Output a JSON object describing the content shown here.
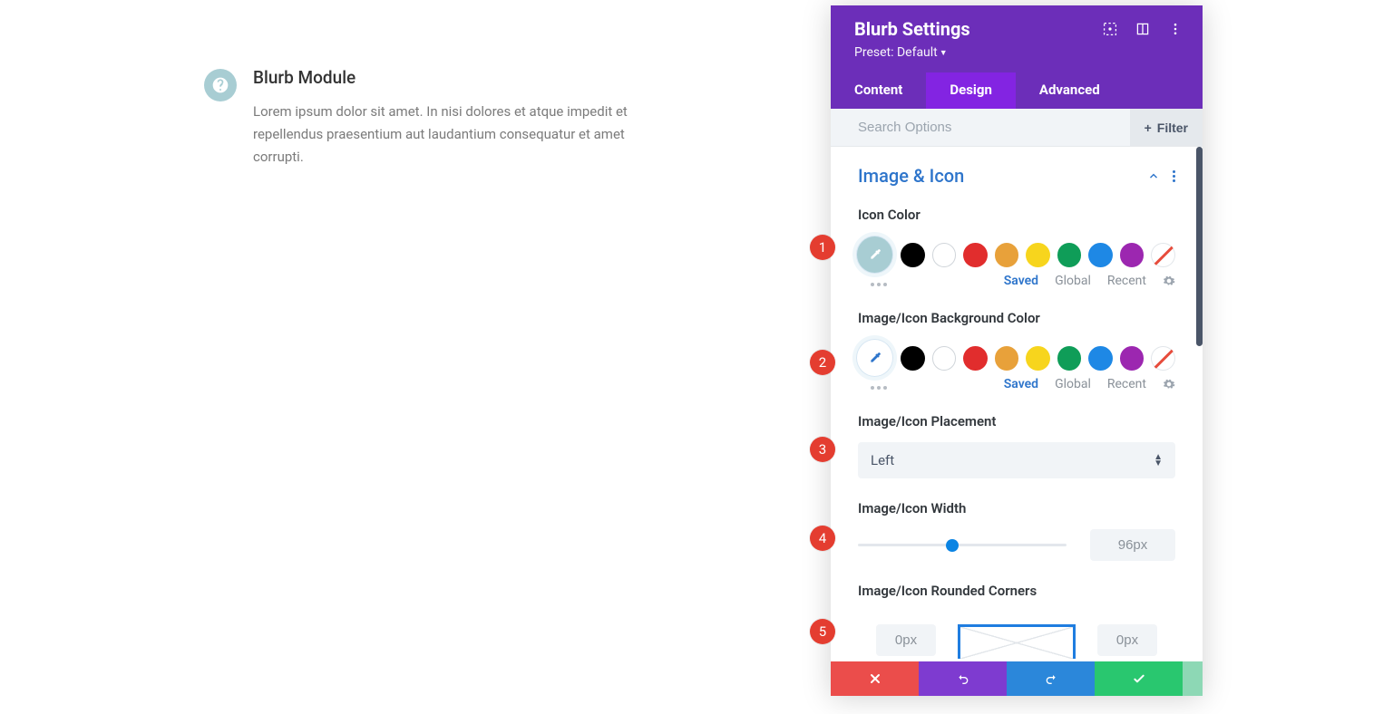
{
  "preview": {
    "title": "Blurb Module",
    "body": "Lorem ipsum dolor sit amet. In nisi dolores et atque impedit et repellendus praesentium aut laudantium consequatur et amet corrupti."
  },
  "panel": {
    "title": "Blurb Settings",
    "preset_label": "Preset: Default",
    "tabs": {
      "content": "Content",
      "design": "Design",
      "advanced": "Advanced"
    },
    "search_placeholder": "Search Options",
    "filter_label": "Filter",
    "section_title": "Image & Icon",
    "icon_color_label": "Icon Color",
    "bg_color_label": "Image/Icon Background Color",
    "palette_links": {
      "saved": "Saved",
      "global": "Global",
      "recent": "Recent"
    },
    "placement_label": "Image/Icon Placement",
    "placement_value": "Left",
    "width_label": "Image/Icon Width",
    "width_value": "96px",
    "width_percent": 45,
    "corners_label": "Image/Icon Rounded Corners",
    "corner_tl": "0px",
    "corner_tr": "0px",
    "swatches": [
      "#000000",
      "#ffffff",
      "#e12d2d",
      "#e8a13a",
      "#f7d51d",
      "#0f9d58",
      "#1e88e5",
      "#9c27b0"
    ]
  },
  "badges": [
    "1",
    "2",
    "3",
    "4",
    "5"
  ]
}
